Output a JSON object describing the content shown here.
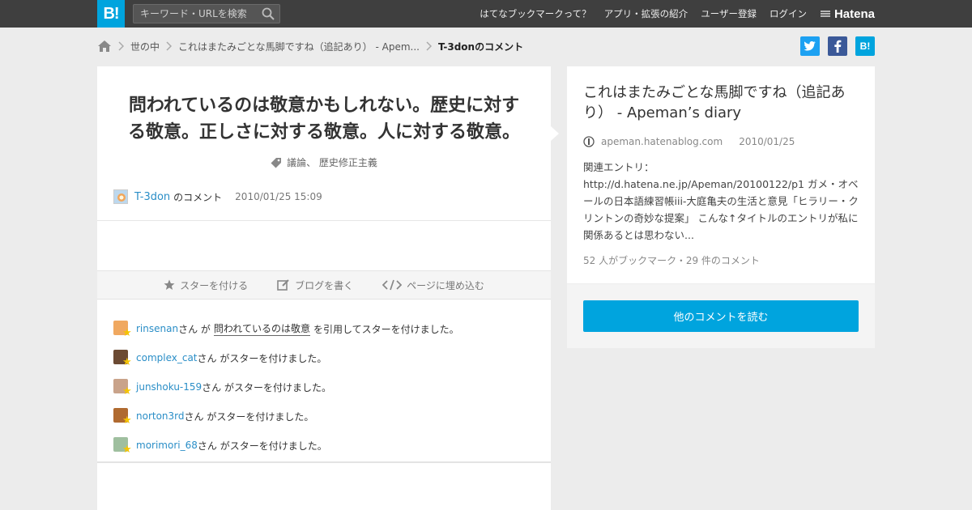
{
  "header": {
    "logo": "B!",
    "search_placeholder": "キーワード・URLを検索",
    "nav": [
      "はてなブックマークって？",
      "アプリ・拡張の紹介",
      "ユーザー登録",
      "ログイン"
    ],
    "brand": "Hatena"
  },
  "breadcrumb": {
    "items": [
      "世の中",
      "これはまたみごとな馬脚ですね（追記あり） - Apem..."
    ],
    "current": "T-3donのコメント"
  },
  "shares": {
    "twitter": "t",
    "facebook": "f",
    "hatena": "B!"
  },
  "comment": {
    "text": "問われているのは敬意かもしれない。歴史に対する敬意。正しさに対する敬意。人に対する敬意。",
    "tags": "議論、 歴史修正主義",
    "user": "T-3don",
    "user_suffix": "のコメント",
    "timestamp": "2010/01/25 15:09"
  },
  "actions": {
    "star": "スターを付ける",
    "blog": "ブログを書く",
    "embed": "ページに埋め込む"
  },
  "stars": [
    {
      "user": "rinsenan",
      "suffix": "さん が",
      "quoted": "問われているのは敬意",
      "after": "を引用してスターを付けました。",
      "avatar_color": "#f0a860"
    },
    {
      "user": "complex_cat",
      "suffix": "さん がスターを付けました。",
      "quoted": "",
      "after": "",
      "avatar_color": "#6b4a33"
    },
    {
      "user": "junshoku-159",
      "suffix": "さん がスターを付けました。",
      "quoted": "",
      "after": "",
      "avatar_color": "#c9a38a"
    },
    {
      "user": "norton3rd",
      "suffix": "さん がスターを付けました。",
      "quoted": "",
      "after": "",
      "avatar_color": "#b06a30"
    },
    {
      "user": "morimori_68",
      "suffix": "さん がスターを付けました。",
      "quoted": "",
      "after": "",
      "avatar_color": "#9fbf9f"
    }
  ],
  "entry": {
    "title": "これはまたみごとな馬脚ですね（追記あり） - Apeman’s diary",
    "domain": "apeman.hatenablog.com",
    "date": "2010/01/25",
    "description": "関連エントリ：http://d.hatena.ne.jp/Apeman/20100122/p1 ガメ・オベールの日本語練習帳iii-大庭亀夫の生活と意見「ヒラリー・クリントンの奇妙な提案」 こんな↑タイトルのエントリが私に関係あるとは思わない...",
    "count": "52 人がブックマーク・29 件のコメント",
    "read_more": "他のコメントを読む"
  }
}
